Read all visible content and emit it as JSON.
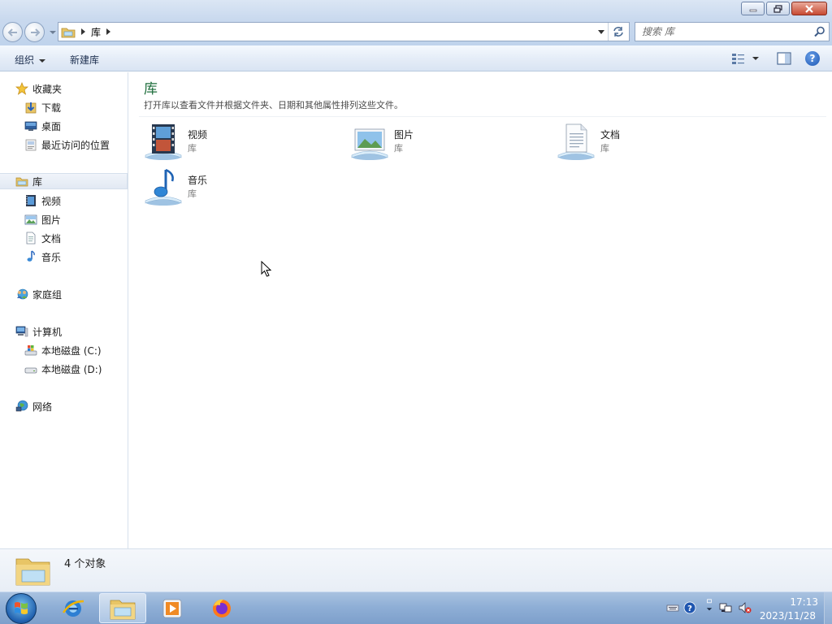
{
  "window": {
    "controls": {
      "minimize": "minimize",
      "restore": "restore",
      "close": "close"
    }
  },
  "address": {
    "crumb": "库",
    "search_placeholder": "搜索 库"
  },
  "toolbar": {
    "organize_label": "组织",
    "new_library_label": "新建库"
  },
  "sidebar": {
    "favorites": {
      "label": "收藏夹",
      "items": [
        "下载",
        "桌面",
        "最近访问的位置"
      ]
    },
    "libraries": {
      "label": "库",
      "items": [
        "视频",
        "图片",
        "文档",
        "音乐"
      ]
    },
    "homegroup": {
      "label": "家庭组"
    },
    "computer": {
      "label": "计算机",
      "items": [
        "本地磁盘 (C:)",
        "本地磁盘 (D:)"
      ]
    },
    "network": {
      "label": "网络"
    }
  },
  "main": {
    "title": "库",
    "description": "打开库以查看文件并根据文件夹、日期和其他属性排列这些文件。",
    "items": [
      {
        "name": "视频",
        "type": "库",
        "icon": "video-library-icon"
      },
      {
        "name": "图片",
        "type": "库",
        "icon": "pictures-library-icon"
      },
      {
        "name": "文档",
        "type": "库",
        "icon": "documents-library-icon"
      },
      {
        "name": "音乐",
        "type": "库",
        "icon": "music-library-icon"
      }
    ]
  },
  "details": {
    "count": "4 个对象"
  },
  "taskbar": {
    "time": "17:13",
    "date": "2023/11/28"
  },
  "colors": {
    "accent_title": "#1e6e3c",
    "titlebar": "#c9d9ee",
    "taskbar": "#8fafd6"
  }
}
